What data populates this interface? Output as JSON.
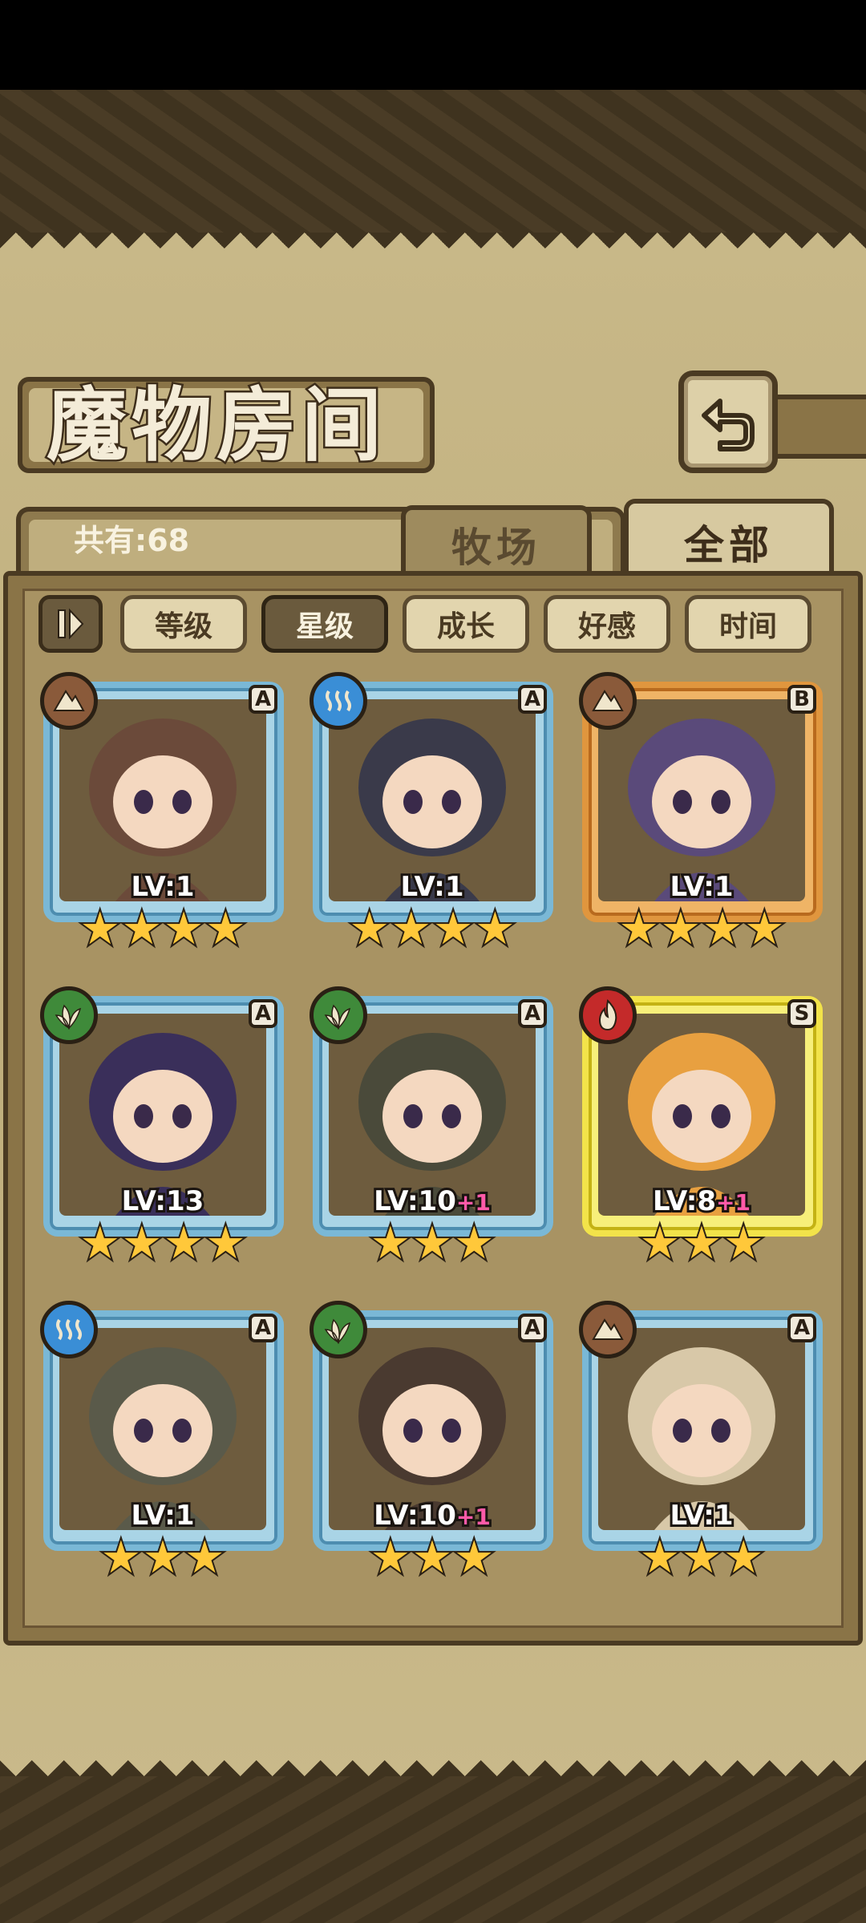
{
  "screen": {
    "title": "魔物房间",
    "count_label": "共有:68",
    "tabs": [
      {
        "label": "牧场",
        "active": false
      },
      {
        "label": "全部",
        "active": true
      }
    ],
    "sort_filters": [
      {
        "label": "等级",
        "active": false
      },
      {
        "label": "星级",
        "active": true
      },
      {
        "label": "成长",
        "active": false
      },
      {
        "label": "好感",
        "active": false
      },
      {
        "label": "时间",
        "active": false
      }
    ]
  },
  "monsters": [
    {
      "element_icon": "earth-icon",
      "rank": "A",
      "level": "LV:1",
      "bonus": "",
      "stars": 4,
      "frame": "blue"
    },
    {
      "element_icon": "water-icon",
      "rank": "A",
      "level": "LV:1",
      "bonus": "",
      "stars": 4,
      "frame": "blue"
    },
    {
      "element_icon": "earth-icon",
      "rank": "B",
      "level": "LV:1",
      "bonus": "",
      "stars": 4,
      "frame": "orange"
    },
    {
      "element_icon": "grass-icon",
      "rank": "A",
      "level": "LV:13",
      "bonus": "",
      "stars": 4,
      "frame": "blue"
    },
    {
      "element_icon": "grass-icon",
      "rank": "A",
      "level": "LV:10",
      "bonus": "+1",
      "stars": 3,
      "frame": "blue"
    },
    {
      "element_icon": "fire-icon",
      "rank": "S",
      "level": "LV:8",
      "bonus": "+1",
      "stars": 3,
      "frame": "yellow"
    },
    {
      "element_icon": "water-icon",
      "rank": "A",
      "level": "LV:1",
      "bonus": "",
      "stars": 3,
      "frame": "blue"
    },
    {
      "element_icon": "grass-icon",
      "rank": "A",
      "level": "LV:10",
      "bonus": "+1",
      "stars": 3,
      "frame": "blue"
    },
    {
      "element_icon": "earth-icon",
      "rank": "A",
      "level": "LV:1",
      "bonus": "",
      "stars": 3,
      "frame": "blue"
    }
  ],
  "colors": {
    "frame_blue": "#7ab8d6",
    "frame_orange": "#e0963e",
    "frame_yellow": "#f2e34a",
    "star": "#ffc83a",
    "bonus": "#ff5aa8"
  }
}
